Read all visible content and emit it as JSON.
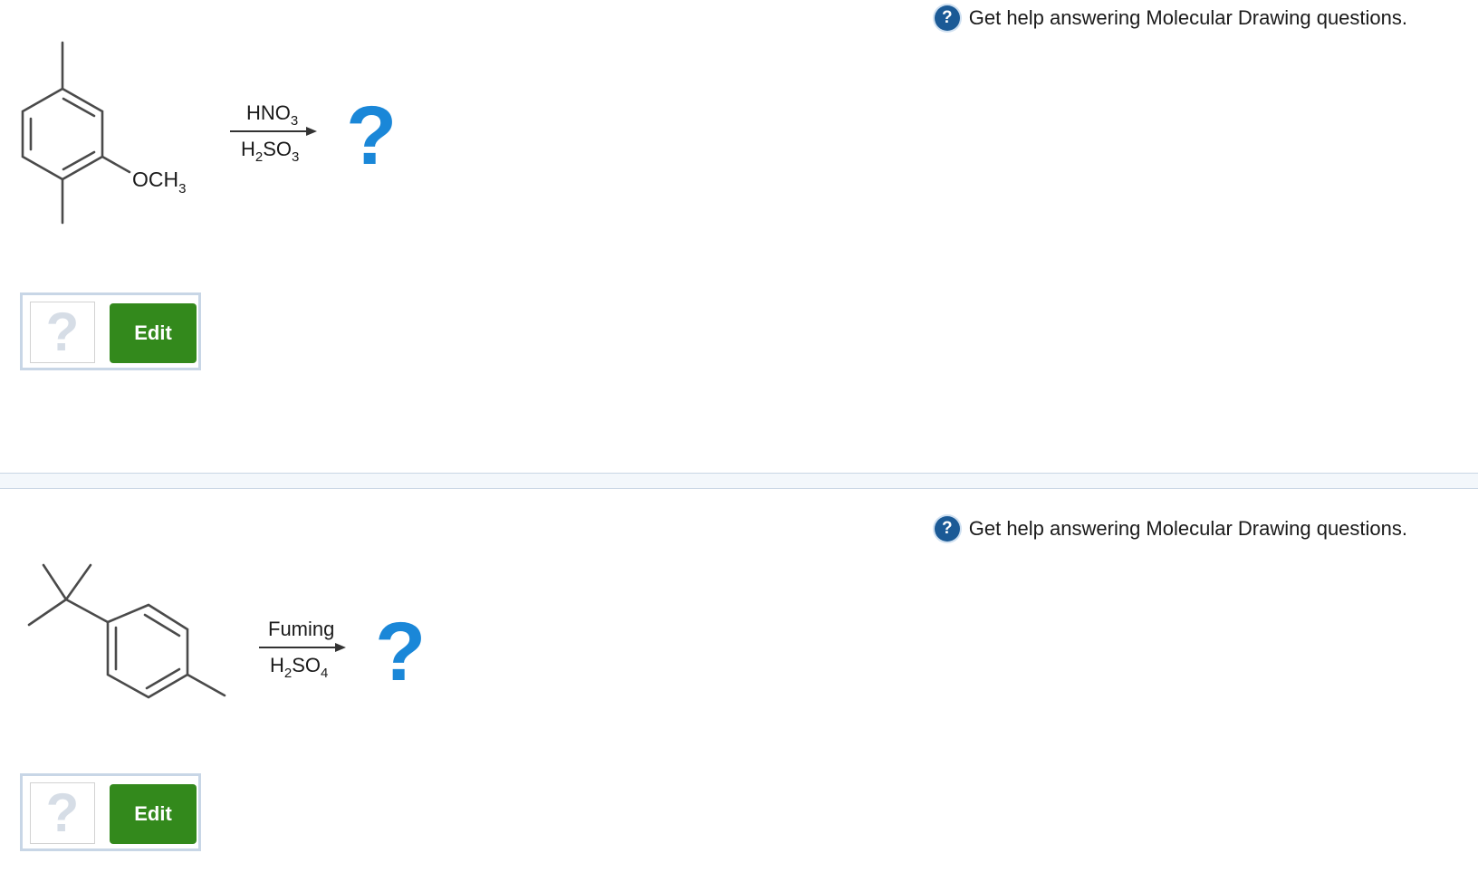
{
  "questions": [
    {
      "help_text": "Get help answering Molecular Drawing questions.",
      "help_icon": "?",
      "substituent": "OCH",
      "substituent_sub": "3",
      "reagent_top_main": "HNO",
      "reagent_top_sub": "3",
      "reagent_bottom_h": "H",
      "reagent_bottom_h_sub": "2",
      "reagent_bottom_main": "SO",
      "reagent_bottom_sub": "3",
      "product_placeholder": "?",
      "answer_placeholder": "?",
      "edit_label": "Edit"
    },
    {
      "help_text": "Get help answering Molecular Drawing questions.",
      "help_icon": "?",
      "reagent_top_main": "Fuming",
      "reagent_bottom_h": "H",
      "reagent_bottom_h_sub": "2",
      "reagent_bottom_main": "SO",
      "reagent_bottom_sub": "4",
      "product_placeholder": "?",
      "answer_placeholder": "?",
      "edit_label": "Edit"
    }
  ],
  "colors": {
    "accent_blue": "#1a87d8",
    "help_icon_bg": "#1b5a96",
    "edit_button_bg": "#33891c",
    "box_border": "#c8d6e6"
  }
}
